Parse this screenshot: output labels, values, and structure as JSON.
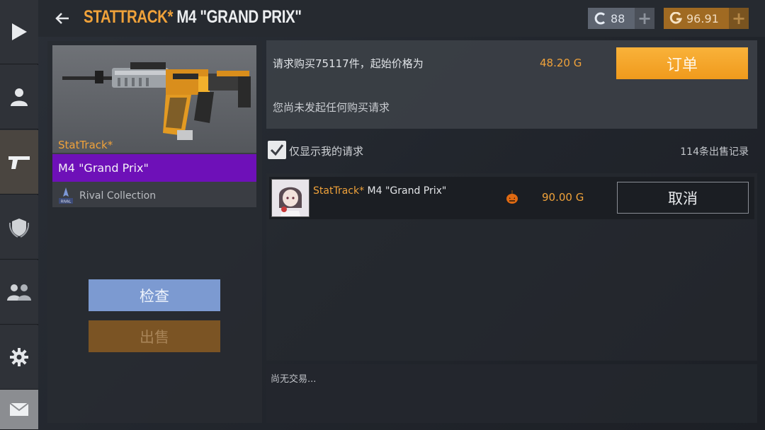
{
  "nav": {
    "items": [
      {
        "icon": "play-icon"
      },
      {
        "icon": "profile-icon"
      },
      {
        "icon": "pistol-icon"
      },
      {
        "icon": "rank-shield-icon"
      },
      {
        "icon": "friends-icon"
      },
      {
        "icon": "gear-icon"
      },
      {
        "icon": "mail-icon"
      }
    ],
    "active_index": 2
  },
  "header": {
    "title_prefix": "STATTRACK*",
    "title_name": "M4 \"GRAND PRIX\"",
    "credits": "88",
    "gold": "96.91",
    "colors": {
      "accent": "#f0a23a",
      "credits_bg": "#5d6470",
      "gold_bg": "#a06a22"
    }
  },
  "item": {
    "stattrack_label": "StatTrack*",
    "name": "M4 \"Grand Prix\"",
    "rarity_color": "#6e10b8",
    "collection": "Rival Collection",
    "collection_icon_text": "RIVAL"
  },
  "actions": {
    "inspect": "检查",
    "sell": "出售"
  },
  "buy_request": {
    "text": "请求购买75117件，起始价格为",
    "price": "48.20 G",
    "order_button": "订单",
    "no_requests": "您尚未发起任何购买请求"
  },
  "filter": {
    "only_mine_label": "仅显示我的请求",
    "only_mine_checked": true,
    "sales_count": "114条出售记录"
  },
  "orders": [
    {
      "stattrack": "StatTrack*",
      "name": " M4 \"Grand Prix\"",
      "price": "90.00 G",
      "cancel": "取消",
      "icon": "pumpkin-icon"
    }
  ],
  "trades": {
    "empty": "尚无交易..."
  }
}
